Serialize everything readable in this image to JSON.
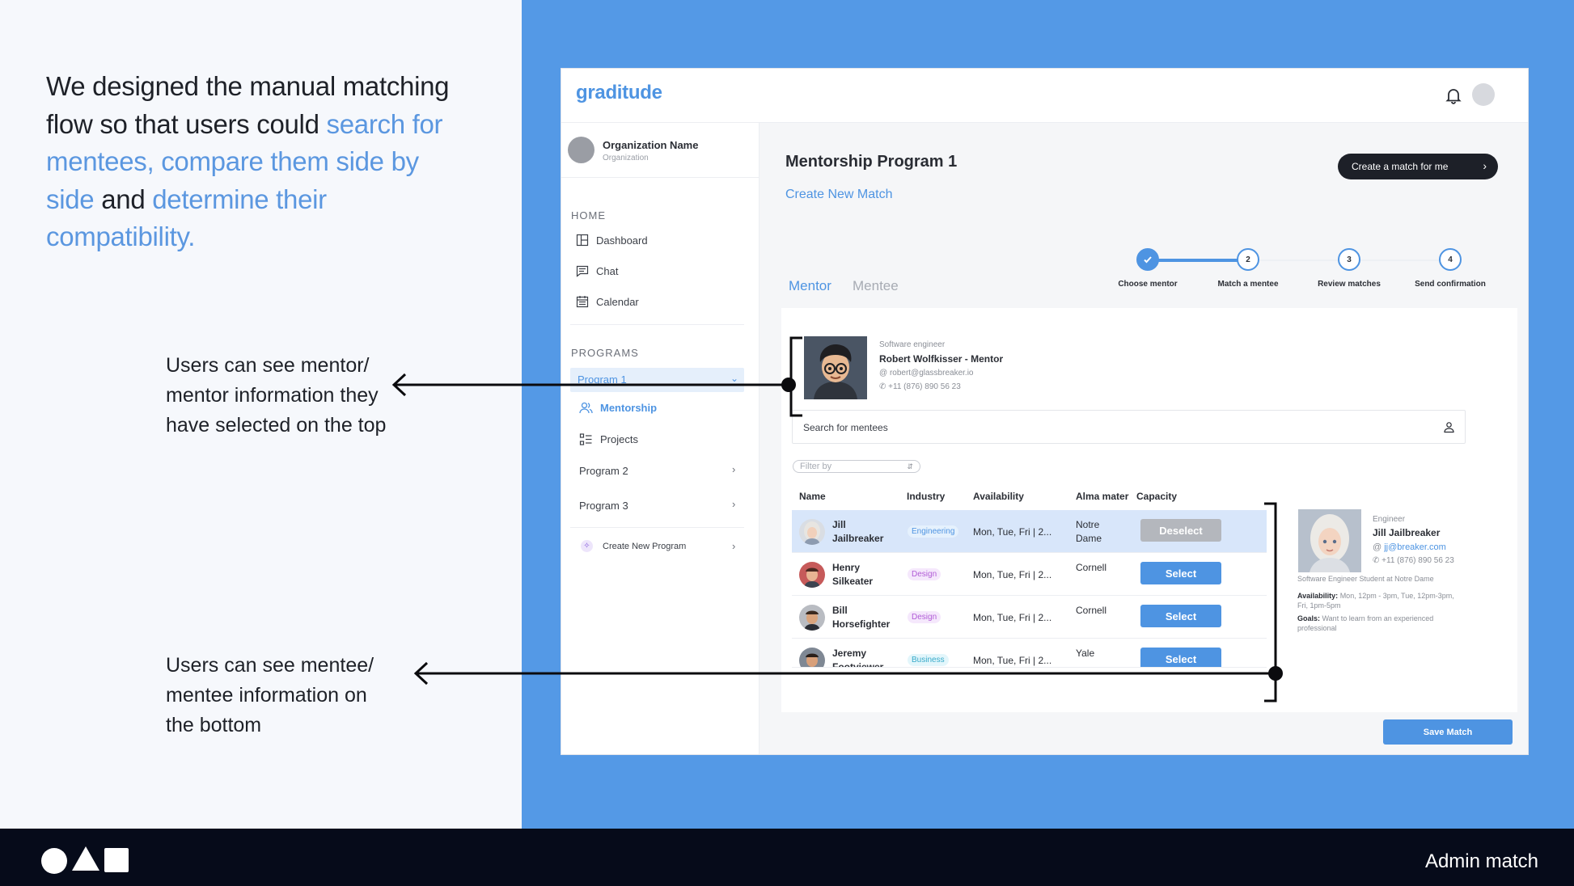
{
  "intro": {
    "p1": "We designed the manual matching flow so that users could ",
    "h1": "search for mentees, compare them side by side",
    "p2": " and ",
    "h2": "determine their compatibility."
  },
  "notes": {
    "top": "Users can see mentor/ mentor information they have selected on the top",
    "bottom": "Users can see mentee/ mentee information on the bottom"
  },
  "footer": {
    "title": "Admin match"
  },
  "app": {
    "logo": "graditude",
    "org": {
      "name": "Organization Name",
      "sub": "Organization"
    },
    "sidebar": {
      "home_label": "HOME",
      "home_items": [
        "Dashboard",
        "Chat",
        "Calendar"
      ],
      "programs_label": "PROGRAMS",
      "active_program": "Program 1",
      "sub_items": [
        "Mentorship",
        "Projects"
      ],
      "programs": [
        "Program 2",
        "Program 3"
      ],
      "create_program": "Create New Program"
    },
    "main": {
      "title": "Mentorship Program 1",
      "subtitle": "Create New Match",
      "cta": "Create a match for me",
      "tabs": [
        "Mentor",
        "Mentee"
      ],
      "steps": [
        {
          "num": "",
          "label": "Choose mentor"
        },
        {
          "num": "2",
          "label": "Match a mentee"
        },
        {
          "num": "3",
          "label": "Review matches"
        },
        {
          "num": "4",
          "label": "Send confirmation"
        }
      ],
      "mentor": {
        "role": "Software engineer",
        "name": "Robert Wolfkisser - Mentor",
        "email": "robert@glassbreaker.io",
        "phone": "+11 (876) 890 56 23"
      },
      "search_placeholder": "Search for mentees",
      "filter_placeholder": "Filter by",
      "columns": [
        "Name",
        "Industry",
        "Availability",
        "Alma mater",
        "Capacity"
      ],
      "rows": [
        {
          "name": "Jill Jailbreaker",
          "industry": "Engineering",
          "availability": "Mon, Tue, Fri  |  2...",
          "alma": "Notre Dame",
          "action": "Deselect"
        },
        {
          "name": "Henry Silkeater",
          "industry": "Design",
          "availability": "Mon, Tue, Fri  |  2...",
          "alma": "Cornell",
          "action": "Select"
        },
        {
          "name": "Bill Horsefighter",
          "industry": "Design",
          "availability": "Mon, Tue, Fri  |  2...",
          "alma": "Cornell",
          "action": "Select"
        },
        {
          "name": "Jeremy Footviewer",
          "industry": "Business",
          "availability": "Mon, Tue, Fri  |  2...",
          "alma": "Yale",
          "action": "Select"
        }
      ],
      "detail": {
        "role": "Engineer",
        "name": "Jill Jailbreaker",
        "email": "jj@breaker.com",
        "phone": "+11 (876) 890 56 23",
        "desc": "Software Engineer Student at Notre Dame",
        "availability_label": "Availability:",
        "availability": " Mon, 12pm - 3pm, Tue, 12pm-3pm, Fri, 1pm-5pm",
        "goals_label": "Goals:",
        "goals": " Want to learn from an experienced professional"
      },
      "save": "Save Match"
    }
  },
  "colors": {
    "accent": "#4e94e2",
    "background_blue": "#5499e6",
    "dark": "#1d2028",
    "deselect_grey": "#b4b7bd"
  },
  "icons": [
    "bell-icon",
    "dashboard-icon",
    "chat-icon",
    "calendar-icon",
    "mentorship-icon",
    "projects-icon",
    "user-search-icon",
    "check-icon"
  ]
}
